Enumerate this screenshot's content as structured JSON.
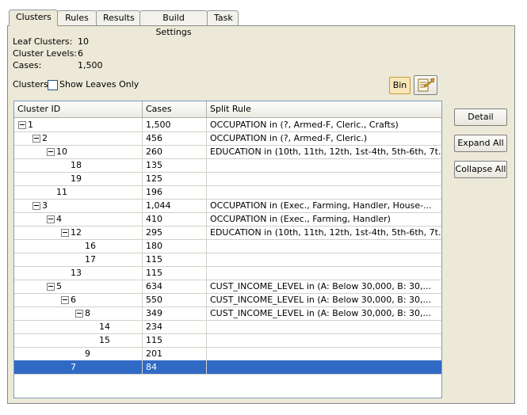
{
  "tabs": [
    "Clusters",
    "Rules",
    "Results",
    "Build Settings",
    "Task"
  ],
  "info": {
    "leaf_clusters_label": "Leaf Clusters:",
    "leaf_clusters": "10",
    "cluster_levels_label": "Cluster Levels:",
    "cluster_levels": "6",
    "cases_label": "Cases:",
    "cases": "1,500"
  },
  "clusters_label": "Clusters:",
  "show_leaves_label": "Show Leaves Only",
  "bin_label": "Bin",
  "columns": [
    "Cluster ID",
    "Cases",
    "Split Rule"
  ],
  "rows": [
    {
      "id": "1",
      "depth": 0,
      "exp": true,
      "cases": "1,500",
      "rule": "OCCUPATION in (?, Armed-F, Cleric., Crafts)"
    },
    {
      "id": "2",
      "depth": 1,
      "exp": true,
      "cases": "456",
      "rule": "OCCUPATION in (?, Armed-F, Cleric.)"
    },
    {
      "id": "10",
      "depth": 2,
      "exp": true,
      "cases": "260",
      "rule": "EDUCATION in (10th, 11th, 12th, 1st-4th, 5th-6th, 7t..."
    },
    {
      "id": "18",
      "depth": 3,
      "exp": false,
      "cases": "135",
      "rule": ""
    },
    {
      "id": "19",
      "depth": 3,
      "exp": false,
      "cases": "125",
      "rule": ""
    },
    {
      "id": "11",
      "depth": 2,
      "exp": false,
      "cases": "196",
      "rule": ""
    },
    {
      "id": "3",
      "depth": 1,
      "exp": true,
      "cases": "1,044",
      "rule": "OCCUPATION in (Exec., Farming, Handler, House-..."
    },
    {
      "id": "4",
      "depth": 2,
      "exp": true,
      "cases": "410",
      "rule": "OCCUPATION in (Exec., Farming, Handler)"
    },
    {
      "id": "12",
      "depth": 3,
      "exp": true,
      "cases": "295",
      "rule": "EDUCATION in (10th, 11th, 12th, 1st-4th, 5th-6th, 7t..."
    },
    {
      "id": "16",
      "depth": 4,
      "exp": false,
      "cases": "180",
      "rule": ""
    },
    {
      "id": "17",
      "depth": 4,
      "exp": false,
      "cases": "115",
      "rule": ""
    },
    {
      "id": "13",
      "depth": 3,
      "exp": false,
      "cases": "115",
      "rule": ""
    },
    {
      "id": "5",
      "depth": 2,
      "exp": true,
      "cases": "634",
      "rule": "CUST_INCOME_LEVEL in (A: Below 30,000, B: 30,..."
    },
    {
      "id": "6",
      "depth": 3,
      "exp": true,
      "cases": "550",
      "rule": "CUST_INCOME_LEVEL in (A: Below 30,000, B: 30,..."
    },
    {
      "id": "8",
      "depth": 4,
      "exp": true,
      "cases": "349",
      "rule": "CUST_INCOME_LEVEL in (A: Below 30,000, B: 30,..."
    },
    {
      "id": "14",
      "depth": 5,
      "exp": false,
      "cases": "234",
      "rule": ""
    },
    {
      "id": "15",
      "depth": 5,
      "exp": false,
      "cases": "115",
      "rule": ""
    },
    {
      "id": "9",
      "depth": 4,
      "exp": false,
      "cases": "201",
      "rule": ""
    },
    {
      "id": "7",
      "depth": 3,
      "exp": false,
      "cases": "84",
      "rule": "",
      "selected": true
    }
  ],
  "buttons": {
    "detail": "Detail",
    "expand_all": "Expand All",
    "collapse_all": "Collapse All"
  }
}
